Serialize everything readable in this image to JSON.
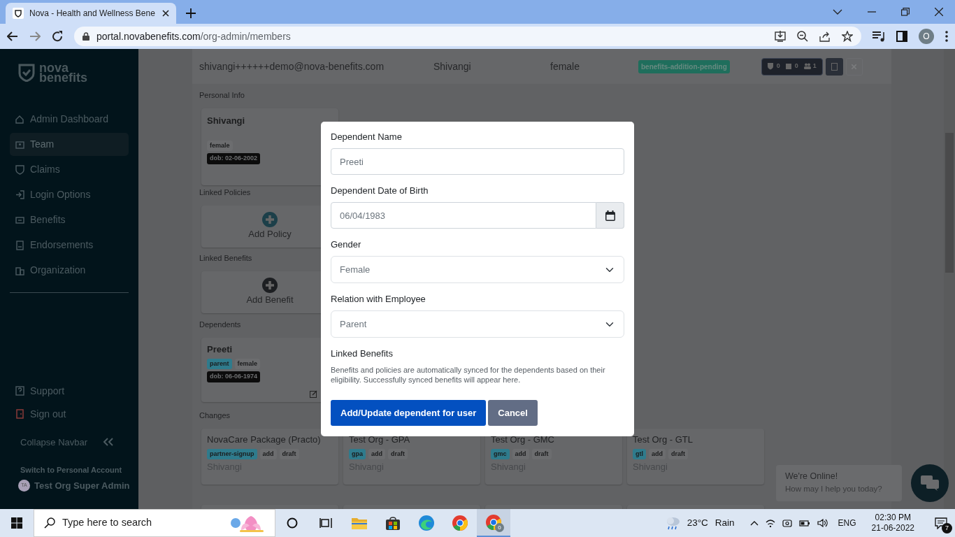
{
  "browser": {
    "tab_title": "Nova - Health and Wellness Bene",
    "url_host": "portal.novabenefits.com",
    "url_path": "/org-admin/members",
    "profile_initial": "O"
  },
  "sidebar": {
    "logo_top": "nova",
    "logo_bottom": "benefits",
    "items": [
      {
        "label": "Admin Dashboard",
        "selected": false
      },
      {
        "label": "Team",
        "selected": true
      },
      {
        "label": "Claims",
        "selected": false
      },
      {
        "label": "Login Options",
        "selected": false
      },
      {
        "label": "Benefits",
        "selected": false
      },
      {
        "label": "Endorsements",
        "selected": false
      },
      {
        "label": "Organization",
        "selected": false
      }
    ],
    "footer_items": [
      {
        "label": "Support",
        "kind": "support"
      },
      {
        "label": "Sign out",
        "kind": "signout"
      }
    ],
    "collapse_label": "Collapse Navbar",
    "switch_label": "Switch to Personal Account",
    "user": {
      "initials": "TA",
      "name": "Test Org Super Admin"
    }
  },
  "member_row": {
    "email": "shivangi++++++demo@nova-benefits.com",
    "name": "Shivangi",
    "gender": "female",
    "status": "benefits-addition-pending",
    "counts": [
      "0",
      "0",
      "1"
    ]
  },
  "personal_info": {
    "heading": "Personal Info",
    "name": "Shivangi",
    "gender": "female",
    "dob": "dob: 02-06-2002"
  },
  "linked_policies": {
    "heading": "Linked Policies",
    "action": "Add Policy"
  },
  "linked_benefits": {
    "heading": "Linked Benefits",
    "action": "Add Benefit"
  },
  "dependents": {
    "heading": "Dependents",
    "cards": [
      {
        "name": "Preeti",
        "relation": "parent",
        "gender": "female",
        "dob": "dob: 06-06-1974"
      }
    ]
  },
  "changes": {
    "heading": "Changes",
    "cards": [
      {
        "title": "NovaCare Package (Practo)",
        "tags": [
          {
            "label": "partner-signup",
            "kind": "type"
          },
          {
            "label": "add",
            "kind": "plain"
          },
          {
            "label": "draft",
            "kind": "plain"
          }
        ],
        "person": "Shivangi"
      },
      {
        "title": "Test Org - GPA",
        "tags": [
          {
            "label": "gpa",
            "kind": "type"
          },
          {
            "label": "add",
            "kind": "plain"
          },
          {
            "label": "draft",
            "kind": "plain"
          }
        ],
        "person": "Shivangi"
      },
      {
        "title": "Test Org - GMC",
        "tags": [
          {
            "label": "gmc",
            "kind": "type"
          },
          {
            "label": "add",
            "kind": "plain"
          },
          {
            "label": "draft",
            "kind": "plain"
          }
        ],
        "person": "Shivangi"
      },
      {
        "title": "Test Org - GTL",
        "tags": [
          {
            "label": "gtl",
            "kind": "type"
          },
          {
            "label": "add",
            "kind": "plain"
          },
          {
            "label": "draft",
            "kind": "plain"
          }
        ],
        "person": "Shivangi"
      }
    ]
  },
  "modal": {
    "fields": [
      {
        "kind": "text",
        "label": "Dependent Name",
        "value": "Preeti"
      },
      {
        "kind": "date",
        "label": "Dependent Date of Birth",
        "value": "06/04/1983"
      },
      {
        "kind": "select",
        "label": "Gender",
        "value": "Female"
      },
      {
        "kind": "select",
        "label": "Relation with Employee",
        "value": "Parent"
      }
    ],
    "linked_label": "Linked Benefits",
    "note": "Benefits and policies are automatically synced for the dependents based on their eligibility. Successfully synced benefits will appear here.",
    "primary_button": "Add/Update dependent for user",
    "cancel_button": "Cancel"
  },
  "chat": {
    "title": "We're Online!",
    "subtitle": "How may I help you today?"
  },
  "taskbar": {
    "search_placeholder": "Type here to search",
    "chrome_badge": "0",
    "temperature": "23°C",
    "weather": "Rain",
    "language": "ENG",
    "time": "02:30 PM",
    "date": "21-06-2022",
    "notifications": "7"
  }
}
